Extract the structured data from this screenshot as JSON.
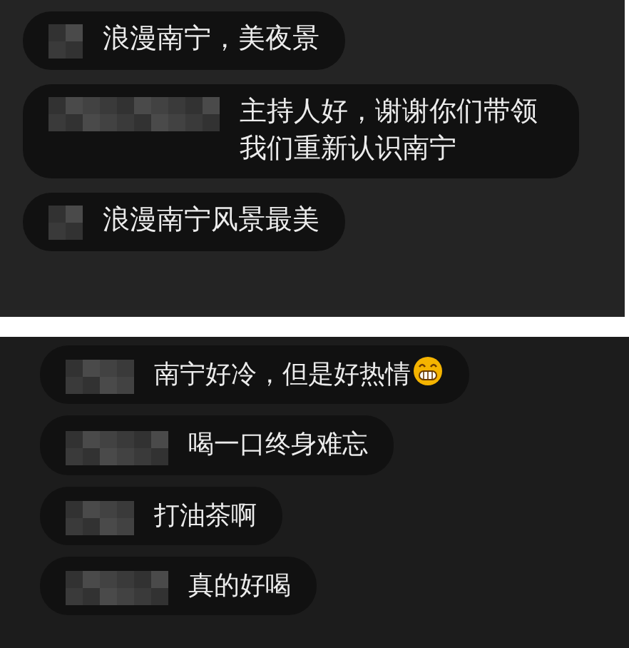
{
  "panels": [
    {
      "comments": [
        {
          "text": "浪漫南宁，美夜景",
          "emoji": false
        },
        {
          "text": "主持人好，谢谢你们带领我们重新认识南宁",
          "emoji": false
        },
        {
          "text": "浪漫南宁风景最美",
          "emoji": false
        }
      ]
    },
    {
      "comments": [
        {
          "text": "南宁好冷，但是好热情",
          "emoji": true
        },
        {
          "text": "喝一口终身难忘",
          "emoji": false
        },
        {
          "text": "打油茶啊",
          "emoji": false
        },
        {
          "text": "真的好喝",
          "emoji": false
        }
      ]
    }
  ]
}
